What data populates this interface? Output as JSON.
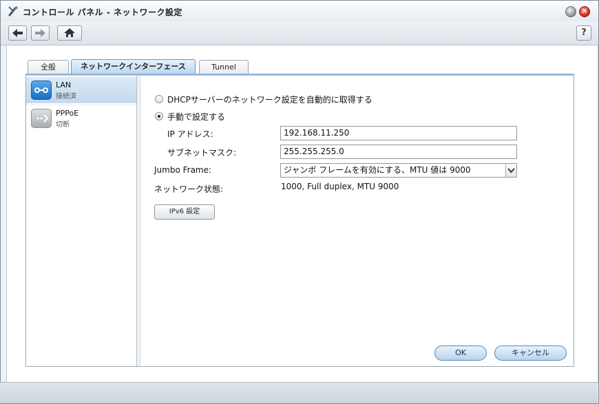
{
  "window": {
    "title": "コントロール パネル - ネットワーク設定",
    "help_label": "?"
  },
  "tabs": [
    {
      "label": "全般"
    },
    {
      "label": "ネットワークインターフェース"
    },
    {
      "label": "Tunnel"
    }
  ],
  "interfaces": [
    {
      "name": "LAN",
      "status": "接続済"
    },
    {
      "name": "PPPoE",
      "status": "切断"
    }
  ],
  "settings": {
    "dhcp_label": "DHCPサーバーのネットワーク設定を自動的に取得する",
    "manual_label": "手動で設定する",
    "ip_label": "IP アドレス:",
    "ip_value": "192.168.11.250",
    "subnet_label": "サブネットマスク:",
    "subnet_value": "255.255.255.0",
    "jumbo_label": "Jumbo Frame:",
    "jumbo_value": "ジャンボ フレームを有効にする、MTU 値は 9000",
    "netstatus_label": "ネットワーク状態:",
    "netstatus_value": "1000, Full duplex, MTU 9000",
    "ipv6_button": "IPv6 設定"
  },
  "buttons": {
    "ok": "OK",
    "cancel": "キャンセル"
  },
  "colors": {
    "selected_tab": "#b9d6f0",
    "accent_blue": "#1d6dbf",
    "close_red": "#d7261a"
  }
}
